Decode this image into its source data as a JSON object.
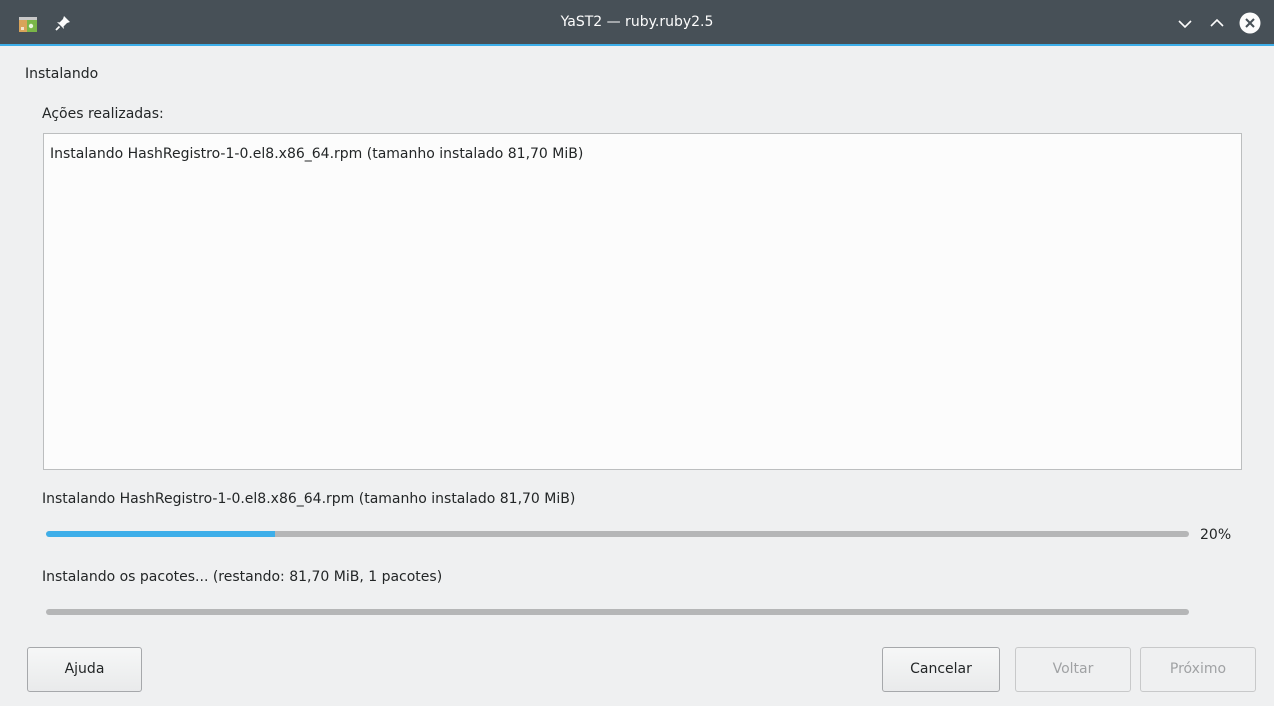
{
  "window": {
    "title": "YaST2 — ruby.ruby2.5",
    "accent_color": "#3daee9",
    "titlebar_color": "#475057",
    "icons": {
      "app": "yast-package-icon",
      "pin": "pin-icon",
      "minimize": "chevron-down-icon",
      "maximize": "chevron-up-icon",
      "close": "close-icon"
    }
  },
  "main": {
    "heading": "Instalando",
    "actions_label": "Ações realizadas:",
    "log_lines": [
      "Instalando HashRegistro-1-0.el8.x86_64.rpm (tamanho instalado 81,70 MiB)"
    ],
    "package_status": "Instalando HashRegistro-1-0.el8.x86_64.rpm (tamanho instalado 81,70 MiB)",
    "package_progress": {
      "value": 0.2,
      "label": "20%"
    },
    "total_status": "Instalando os pacotes... (restando: 81,70 MiB, 1 pacotes)",
    "total_progress": {
      "value": 0.0
    }
  },
  "buttons": {
    "help": "Ajuda",
    "cancel": "Cancelar",
    "back": "Voltar",
    "next": "Próximo"
  }
}
